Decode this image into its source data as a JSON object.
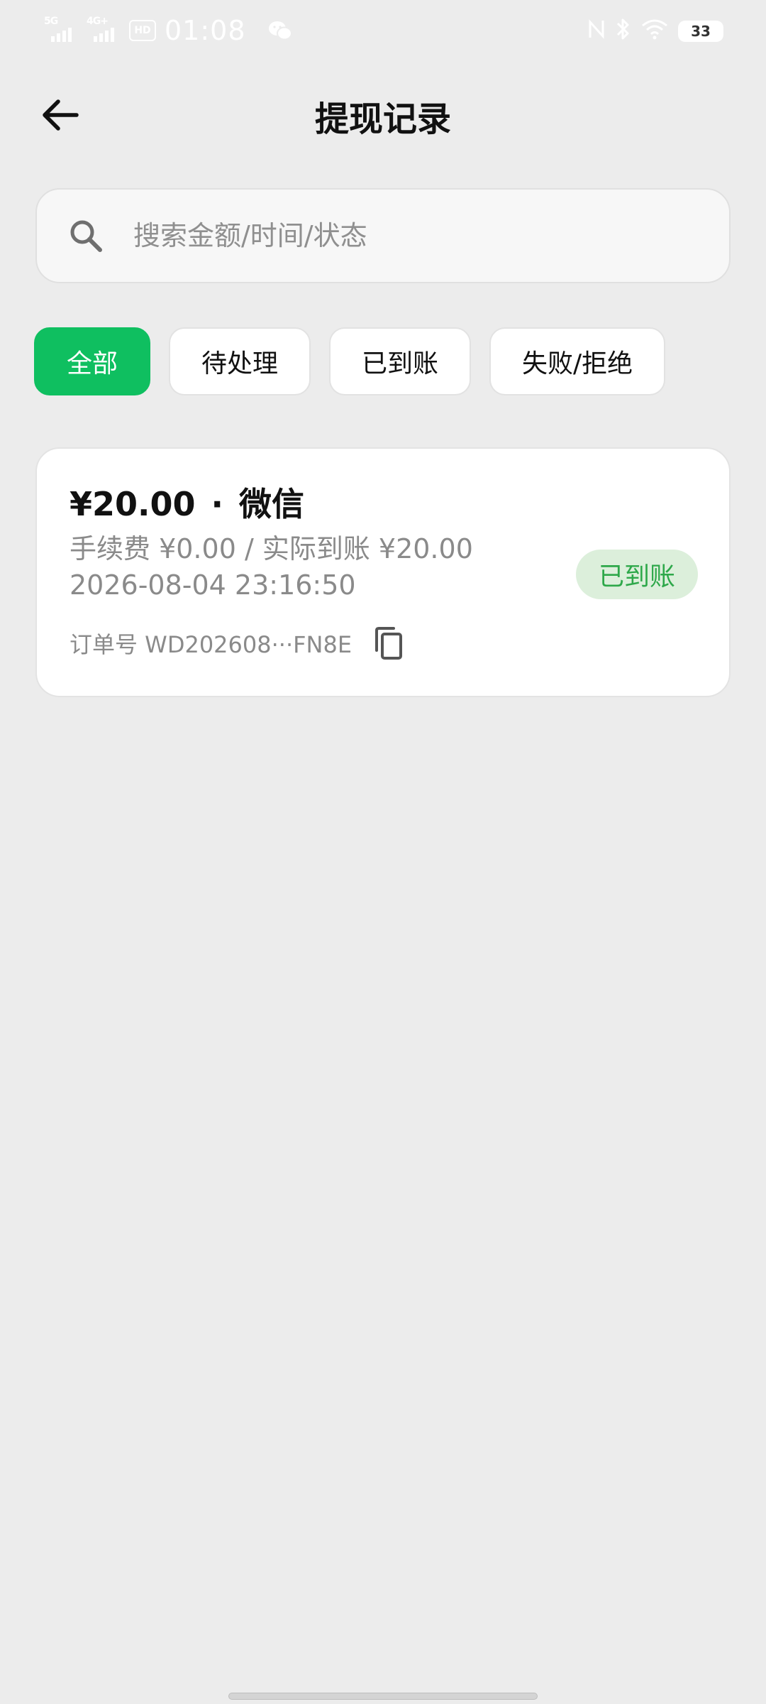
{
  "status_bar": {
    "signal_1_label": "5G",
    "signal_2_label": "4G+",
    "hd_label": "HD",
    "time": "01:08",
    "battery": "33",
    "icons": [
      "signal-5g-icon",
      "signal-4g-icon",
      "hd-voice-icon",
      "wechat-icon",
      "nfc-icon",
      "bluetooth-icon",
      "wifi-icon",
      "battery-icon"
    ]
  },
  "header": {
    "title": "提现记录",
    "back_icon": "arrow-left-icon"
  },
  "search": {
    "placeholder": "搜索金额/时间/状态",
    "value": "",
    "icon": "search-icon"
  },
  "filters": {
    "active_index": 0,
    "items": [
      {
        "label": "全部"
      },
      {
        "label": "待处理"
      },
      {
        "label": "已到账"
      },
      {
        "label": "失败/拒绝"
      }
    ]
  },
  "records": [
    {
      "amount": "¥20.00",
      "separator": "·",
      "channel": "微信",
      "fee_line": "手续费 ¥0.00 / 实际到账 ¥20.00",
      "time": "2026-08-04 23:16:50",
      "order_line": "订单号 WD202608···FN8E",
      "status": "已到账",
      "copy_icon": "copy-icon"
    }
  ],
  "colors": {
    "accent": "#0fbf60",
    "background": "#ececec",
    "status_success_text": "#2ea84a",
    "status_success_bg": "#dcefdb",
    "muted_text": "#8a8a8a"
  }
}
